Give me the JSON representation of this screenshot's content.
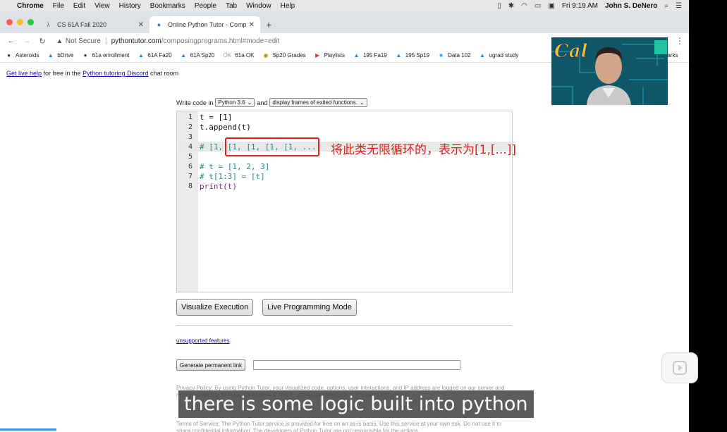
{
  "menubar": {
    "app": "Chrome",
    "items": [
      "File",
      "Edit",
      "View",
      "History",
      "Bookmarks",
      "People",
      "Tab",
      "Window",
      "Help"
    ],
    "clock": "Fri 9:19 AM",
    "user": "John S. DeNero"
  },
  "tabs": [
    {
      "title": "CS 61A Fall 2020",
      "icon": "lambda-icon",
      "glyph": "λ"
    },
    {
      "title": "Online Python Tutor - Compo",
      "icon": "python-icon",
      "glyph": "●"
    }
  ],
  "address": {
    "security": "Not Secure",
    "host": "pythontutor.com",
    "path": "/composingprograms.html#mode=edit"
  },
  "bookmarks": [
    {
      "label": "Asteroids",
      "glyph": "●",
      "color": "#333"
    },
    {
      "label": "bDrive",
      "glyph": "▲",
      "color": "#1e88e5"
    },
    {
      "label": "61a enrollment",
      "glyph": "●",
      "color": "#333"
    },
    {
      "label": "61A Fa20",
      "glyph": "▲",
      "color": "#1e88e5"
    },
    {
      "label": "61A Sp20",
      "glyph": "▲",
      "color": "#1e88e5"
    },
    {
      "label": "61a OK",
      "glyph": "OK",
      "color": "#999"
    },
    {
      "label": "Sp20 Grades",
      "glyph": "◉",
      "color": "#b8860b"
    },
    {
      "label": "Playlists",
      "glyph": "▶",
      "color": "#e53935"
    },
    {
      "label": "195 Fa19",
      "glyph": "▲",
      "color": "#1e88e5"
    },
    {
      "label": "195 Sp19",
      "glyph": "▲",
      "color": "#1e88e5"
    },
    {
      "label": "Data 102",
      "glyph": "■",
      "color": "#42a5f5"
    },
    {
      "label": "ugrad study",
      "glyph": "▲",
      "color": "#1e88e5"
    }
  ],
  "bookmarks_overflow": "narks",
  "help": {
    "link": "Get live help",
    "middle": " for free in the ",
    "discord": "Python tutoring Discord",
    "end": " chat room"
  },
  "write": {
    "prefix": "Write code in",
    "language": "Python 3.6",
    "and": "and",
    "frames": "display frames of exited functions."
  },
  "code": [
    {
      "n": "1",
      "text": "t = [1]",
      "style": "normal"
    },
    {
      "n": "2",
      "text": "t.append(t)",
      "style": "normal"
    },
    {
      "n": "3",
      "text": "",
      "style": "normal"
    },
    {
      "n": "4",
      "text": "# [1, [1, [1, [1, [1, ...",
      "style": "comment"
    },
    {
      "n": "5",
      "text": "",
      "style": "normal"
    },
    {
      "n": "6",
      "text": "# t = [1, 2, 3]",
      "style": "comment"
    },
    {
      "n": "7",
      "text": "# t[1:3] = [t]",
      "style": "comment"
    },
    {
      "n": "8",
      "text": "print(t)",
      "style": "keyword"
    }
  ],
  "annotation": "将此类无限循环的，表示为[1,[...]]",
  "buttons": {
    "visualize": "Visualize Execution",
    "live": "Live Programming Mode",
    "permanent": "Generate permanent link"
  },
  "unsupported": "unsupported features",
  "privacy": "Privacy Policy: By using Python Tutor, your visualized code, options, user interactions, and IP address are logged on our server and may be analyzed for research purposes. Nearly all web services collect this basic information",
  "terms": "Terms of Service: The Python Tutor service is provided for free on an as-is basis. Use this service at your own risk. Do not use it to share confidential information. The developers of Python Tutor are not responsible for the actions",
  "caption": "there is some logic built into python",
  "colors": {
    "accent_red": "#e0201a",
    "link": "#1a0dab",
    "comment": "#1b8a84"
  }
}
